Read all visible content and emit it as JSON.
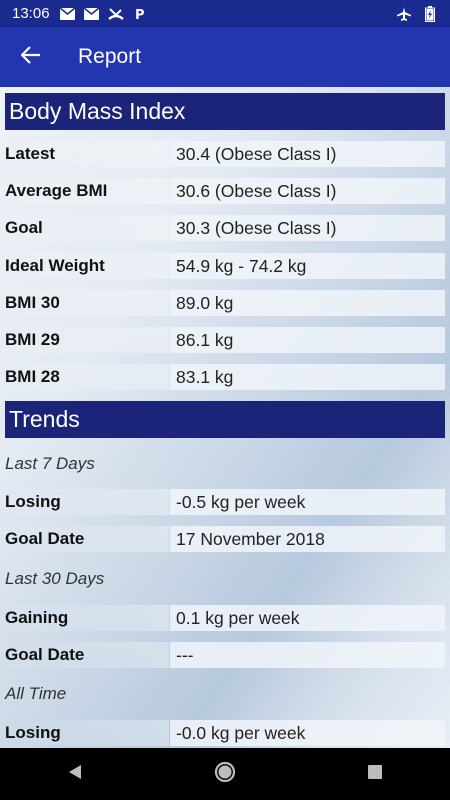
{
  "status_bar": {
    "time": "13:06",
    "left_icons": [
      "mail-icon",
      "mail-icon",
      "missed-call-icon",
      "parking-icon"
    ],
    "right_icons": [
      "airplane-icon",
      "battery-charging-icon"
    ]
  },
  "app_bar": {
    "title": "Report"
  },
  "bmi_section": {
    "title": "Body Mass Index",
    "rows": [
      {
        "label": "Latest",
        "value": "30.4 (Obese Class I)"
      },
      {
        "label": "Average BMI",
        "value": "30.6 (Obese Class I)"
      },
      {
        "label": "Goal",
        "value": "30.3 (Obese Class I)"
      },
      {
        "label": "Ideal Weight",
        "value": "54.9 kg - 74.2 kg"
      },
      {
        "label": "BMI 30",
        "value": "89.0 kg"
      },
      {
        "label": "BMI 29",
        "value": "86.1 kg"
      },
      {
        "label": "BMI 28",
        "value": "83.1 kg"
      }
    ]
  },
  "trends_section": {
    "title": "Trends",
    "groups": [
      {
        "period": "Last 7 Days",
        "rows": [
          {
            "label": "Losing",
            "value": "-0.5 kg per week"
          },
          {
            "label": "Goal Date",
            "value": "17 November 2018"
          }
        ]
      },
      {
        "period": "Last 30 Days",
        "rows": [
          {
            "label": "Gaining",
            "value": "0.1 kg per week"
          },
          {
            "label": "Goal Date",
            "value": "---"
          }
        ]
      },
      {
        "period": "All Time",
        "rows": [
          {
            "label": "Losing",
            "value": "-0.0 kg per week"
          }
        ]
      }
    ]
  },
  "nav_bar": {
    "buttons": [
      "back-nav-icon",
      "home-nav-icon",
      "recents-nav-icon"
    ]
  },
  "colors": {
    "status_bar": "#1b2a8e",
    "app_bar": "#2336b0",
    "section_header": "#1b2478"
  }
}
